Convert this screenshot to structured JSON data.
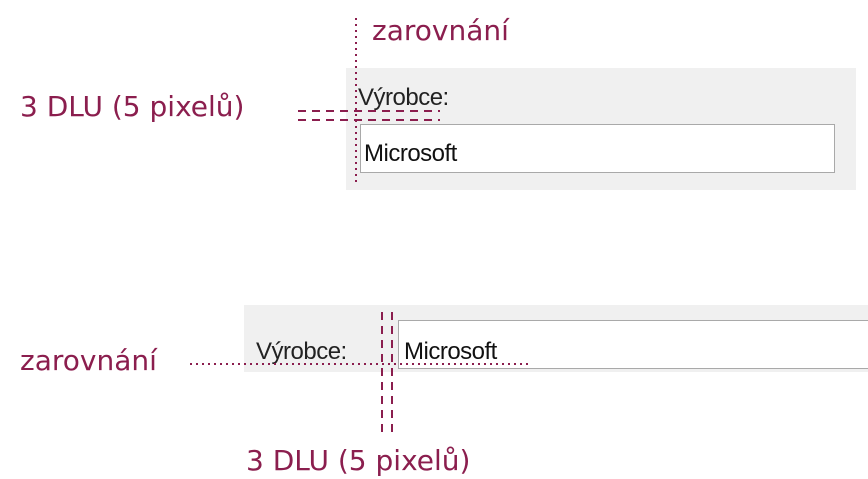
{
  "colors": {
    "annotation": "#8b1e4e",
    "panel": "#f0f0f0",
    "border": "#a9a9a9"
  },
  "top_example": {
    "alignment_label": "zarovnání",
    "spacing_label": "3 DLU (5 pixelů)",
    "field_label": "Výrobce:",
    "field_value": "Microsoft"
  },
  "bottom_example": {
    "alignment_label": "zarovnání",
    "spacing_label": "3 DLU (5 pixelů)",
    "field_label": "Výrobce:",
    "field_value": "Microsoft"
  }
}
